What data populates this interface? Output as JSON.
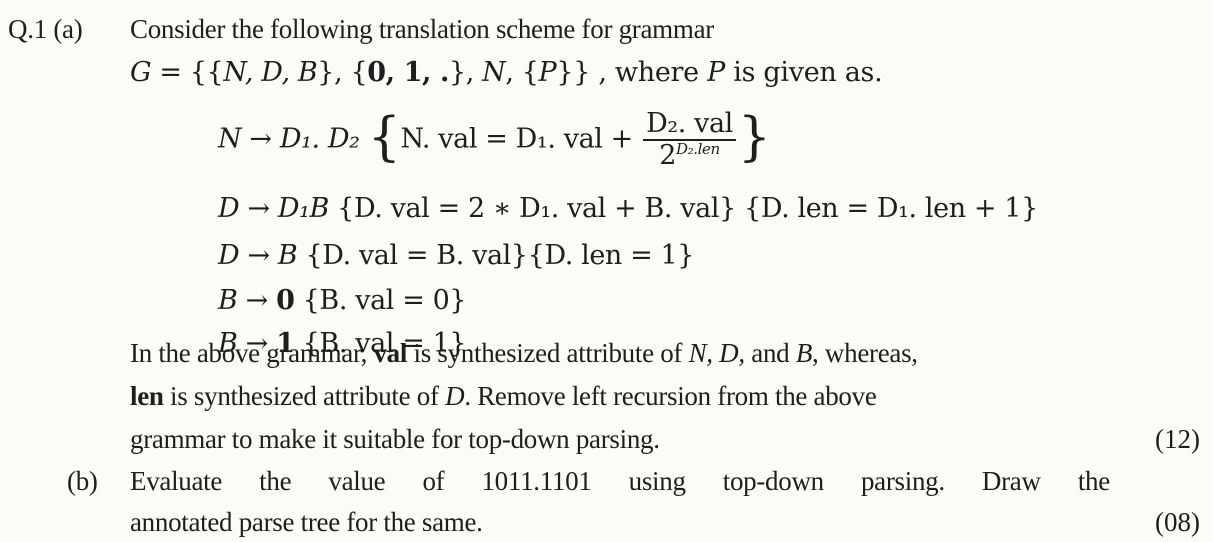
{
  "question": {
    "number": "Q.1",
    "part_a": {
      "label": "(a)",
      "intro": "Consider the following translation scheme for grammar",
      "grammar_def": {
        "prefix": "G = {{",
        "nonterminals": "N, D, B",
        "mid1": "}, {",
        "terminals": "0,  1,  .",
        "mid2": "}, ",
        "start": "N",
        "mid3": ", {",
        "prod": "P",
        "suffix": "}} , where ",
        "p": "P",
        "tail": " is given as."
      },
      "productions": [
        {
          "id": "p1",
          "lhs": "N",
          "arrow": "→",
          "rhs": "D₁. D₂",
          "action_prefix": "N. val = D₁. val + ",
          "fraction_num": "D₂. val",
          "fraction_den_base": "2",
          "fraction_den_exp": "D₂.len"
        },
        {
          "id": "p2",
          "lhs": "D",
          "arrow": "→",
          "rhs": "D₁B",
          "action1": "D. val = 2 ∗ D₁. val + B. val",
          "action2": "D. len = D₁. len + 1"
        },
        {
          "id": "p3",
          "lhs": "D",
          "arrow": "→",
          "rhs": "B",
          "action1": "D. val = B. val",
          "action2": "D. len = 1"
        },
        {
          "id": "p4",
          "lhs": "B",
          "arrow": "→",
          "rhs": "0",
          "action1": "B. val = 0"
        },
        {
          "id": "p5",
          "lhs": "B",
          "arrow": "→",
          "rhs": "1",
          "action1": "B. val = 1"
        }
      ],
      "paragraph": {
        "line1_a": "In the above grammar, ",
        "line1_b": "val",
        "line1_c": " is synthesized attribute of ",
        "line1_d": "N, D,",
        "line1_e": " and ",
        "line1_f": "B",
        "line1_g": ", whereas,",
        "line2_a": "len",
        "line2_b": " is synthesized attribute of ",
        "line2_c": "D",
        "line2_d": ". Remove left recursion from the above",
        "line3": "grammar to make it suitable for top-down parsing."
      },
      "marks": "(12)"
    },
    "part_b": {
      "label": "(b)",
      "line1_words": [
        "Evaluate",
        "the",
        "value",
        "of",
        "1011.1101",
        "using",
        "top-down",
        "parsing.",
        "Draw",
        "the"
      ],
      "line2": "annotated parse tree for the same.",
      "marks": "(08)"
    }
  }
}
